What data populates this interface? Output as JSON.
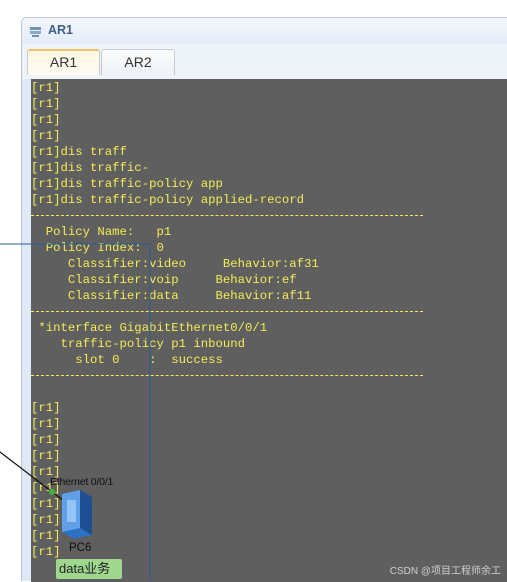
{
  "window": {
    "title": "AR1"
  },
  "tabs": [
    {
      "label": "AR1",
      "active": true
    },
    {
      "label": "AR2",
      "active": false
    }
  ],
  "console": {
    "text_color": "#f2ec57",
    "background": "#5f5f5f",
    "lines_top": [
      "[r1]",
      "[r1]",
      "[r1]",
      "[r1]",
      "[r1]dis traff",
      "[r1]dis traffic-",
      "[r1]dis traffic-policy app",
      "[r1]dis traffic-policy applied-record"
    ],
    "policy": {
      "name_line": "  Policy Name:   p1",
      "index_line": "  Policy Index:  0",
      "classifiers": [
        "     Classifier:video     Behavior:af31",
        "     Classifier:voip     Behavior:ef",
        "     Classifier:data     Behavior:af11"
      ]
    },
    "interface_lines": [
      " *interface GigabitEthernet0/0/1",
      "    traffic-policy p1 inbound",
      "      slot 0    :  success"
    ],
    "lines_bottom": [
      "[r1]",
      "[r1]",
      "[r1]",
      "[r1]",
      "[r1]",
      "[r1]",
      "[r1]",
      "[r1]",
      "[r1]",
      "[r1]"
    ]
  },
  "topology": {
    "port_label": "Ethernet 0/0/1",
    "pc_label": "PC6",
    "badge_label": "data业务"
  },
  "watermark": "CSDN @项目工程师余工"
}
